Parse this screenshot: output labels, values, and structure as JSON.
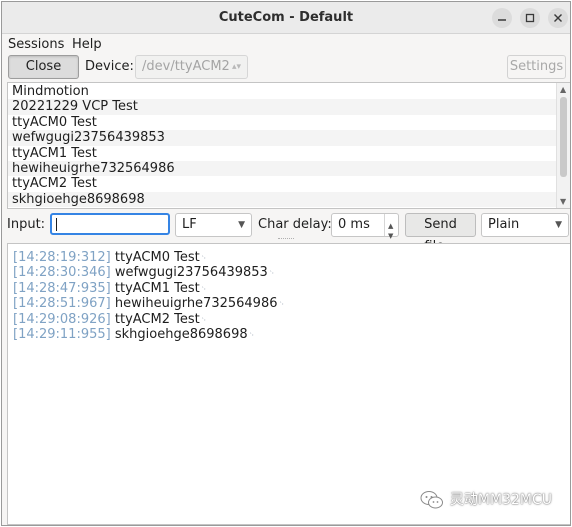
{
  "window": {
    "title": "CuteCom - Default",
    "controls": [
      "minimize-icon",
      "maximize-icon",
      "close-icon"
    ]
  },
  "menubar": {
    "items": [
      {
        "label": "Sessions",
        "mnemonic": "e"
      },
      {
        "label": "Help",
        "mnemonic": "H"
      }
    ]
  },
  "toolbar": {
    "close_label": "Close",
    "device_label": "Device:",
    "device_value": "/dev/ttyACM2",
    "settings_label": "Settings"
  },
  "command_history": [
    "Mindmotion",
    "20221229 VCP Test",
    "ttyACM0 Test",
    "wefwgugi23756439853",
    "ttyACM1 Test",
    "hewiheuigrhe732564986",
    "ttyACM2 Test",
    "skhgioehge8698698"
  ],
  "input_bar": {
    "input_label": "Input:",
    "input_value": "",
    "line_end": "LF",
    "char_delay_label": "Char delay:",
    "char_delay_value": "0 ms",
    "send_file_label": "Send file...",
    "format": "Plain"
  },
  "output_log": [
    {
      "time": "[14:28:19:312]",
      "text": "ttyACM0 Test"
    },
    {
      "time": "[14:28:30:346]",
      "text": "wefwgugi23756439853"
    },
    {
      "time": "[14:28:47:935]",
      "text": "ttyACM1 Test"
    },
    {
      "time": "[14:28:51:967]",
      "text": "hewiheuigrhe732564986"
    },
    {
      "time": "[14:29:08:926]",
      "text": "ttyACM2 Test"
    },
    {
      "time": "[14:29:11:955]",
      "text": "skhgioehge8698698"
    }
  ],
  "watermark": {
    "text": "灵动MM32MCU",
    "icon": "wechat-icon"
  },
  "colors": {
    "timestamp": "#7fa2c4",
    "focus": "#3584e4",
    "titlebar": "#ebebeb"
  }
}
